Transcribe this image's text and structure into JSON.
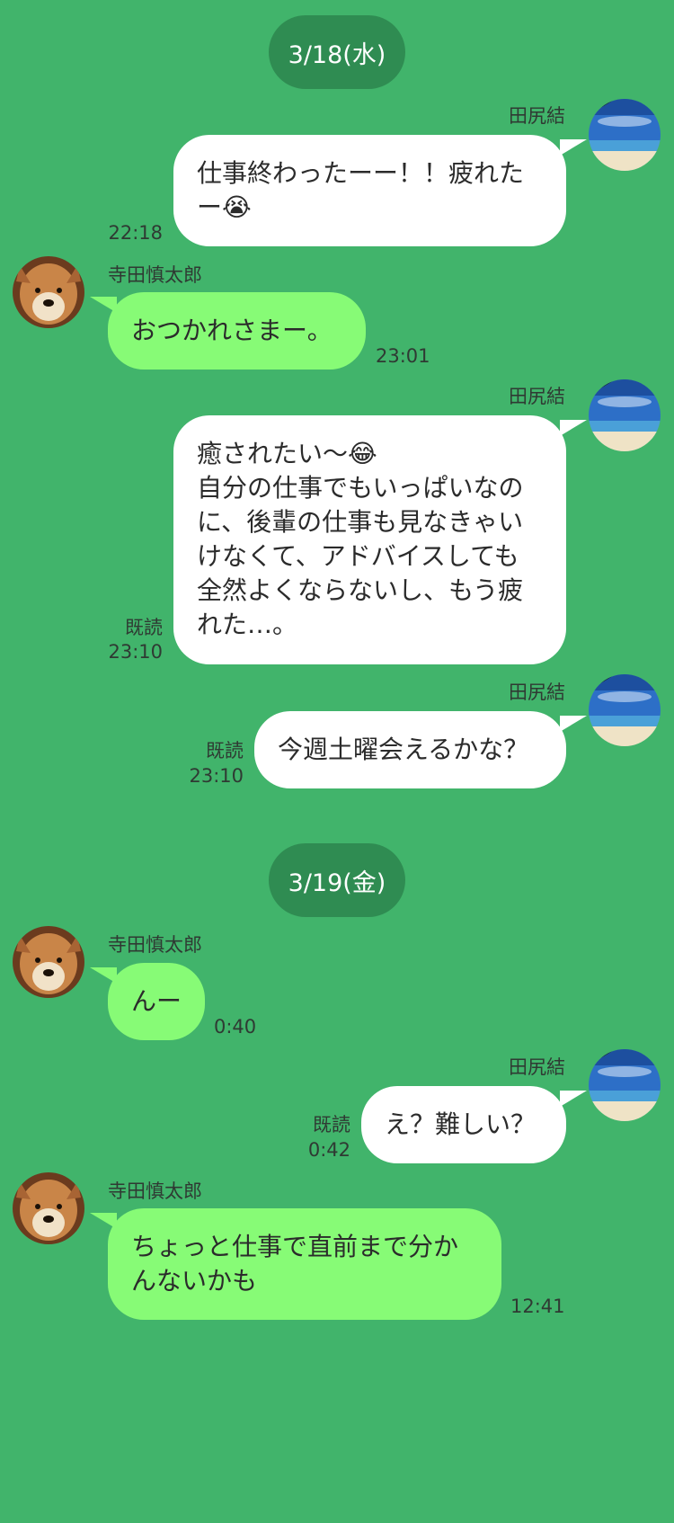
{
  "colors": {
    "background": "#41b46b",
    "date_pill": "#2f8c52",
    "outgoing_bubble": "#ffffff",
    "incoming_bubble": "#87fb76"
  },
  "dates": [
    "3/18(水)",
    "3/19(金)"
  ],
  "senders": {
    "self": "田尻結",
    "friend": "寺田慎太郎"
  },
  "messages": [
    {
      "text": "仕事終わったーー！！疲れたー😭",
      "time": "22:18",
      "read": ""
    },
    {
      "text": "おつかれさまー。",
      "time": "23:01",
      "read": ""
    },
    {
      "text": "癒されたい〜😂\n自分の仕事でもいっぱいなのに、後輩の仕事も見なきゃいけなくて、アドバイスしても全然よくならないし、もう疲れた…。",
      "time": "23:10",
      "read": "既読"
    },
    {
      "text": "今週土曜会えるかな？",
      "time": "23:10",
      "read": "既読"
    },
    {
      "text": "んー",
      "time": "0:40",
      "read": ""
    },
    {
      "text": "え？難しい？",
      "time": "0:42",
      "read": "既読"
    },
    {
      "text": "ちょっと仕事で直前まで分かんないかも",
      "time": "12:41",
      "read": ""
    }
  ],
  "avatars": {
    "self": "beach-photo-avatar",
    "friend": "shiba-dog-avatar"
  }
}
